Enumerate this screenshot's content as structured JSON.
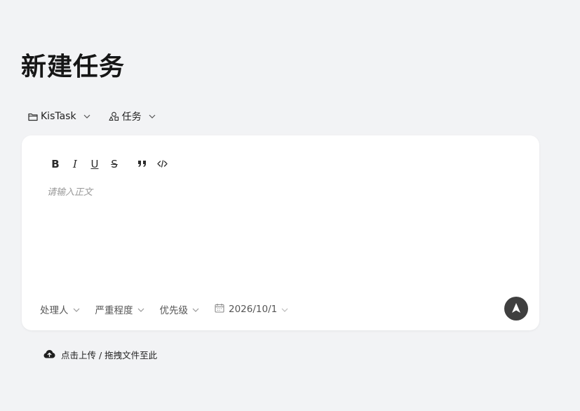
{
  "page": {
    "title": "新建任务"
  },
  "selectors": {
    "project": {
      "label": "KisTask",
      "icon": "folder-icon"
    },
    "type": {
      "label": "任务",
      "icon": "shapes-icon"
    }
  },
  "toolbar": {
    "bold": "B",
    "italic": "I",
    "underline": "U",
    "strike": "S",
    "quote_icon": "quote-icon",
    "code_icon": "code-icon"
  },
  "editor": {
    "placeholder": "请输入正文",
    "value": ""
  },
  "meta": {
    "assignee": "处理人",
    "severity": "严重程度",
    "priority": "优先级",
    "date": "2026/10/1"
  },
  "upload": {
    "label": "点击上传 / 拖拽文件至此",
    "icon": "cloud-upload-icon"
  },
  "colors": {
    "background": "#f2f3f5",
    "card": "#ffffff",
    "submit": "#3f3f3f",
    "placeholder": "#9a9a9a"
  }
}
